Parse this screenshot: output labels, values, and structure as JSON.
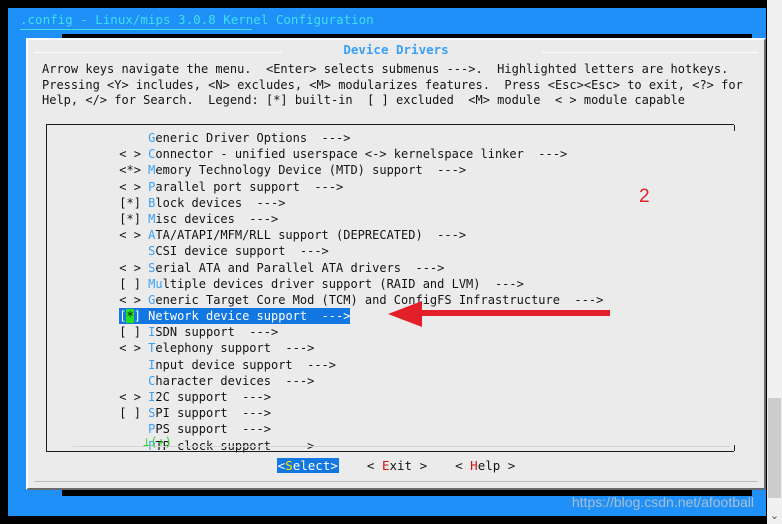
{
  "terminal": {
    "title": ".config - Linux/mips 3.0.8 Kernel Configuration"
  },
  "dialog": {
    "title": "Device Drivers",
    "help_line1": "Arrow keys navigate the menu.  <Enter> selects submenus --->.  Highlighted letters are hotkeys.",
    "help_line2": "Pressing <Y> includes, <N> excludes, <M> modularizes features.  Press <Esc><Esc> to exit, <?> for",
    "help_line3": "Help, </> for Search.  Legend: [*] built-in  [ ] excluded  <M> module  < > module capable",
    "scroll_indicator": "⊥(+)"
  },
  "menu": {
    "items": [
      {
        "tag": "    ",
        "hotkey": "G",
        "label": "eneric Driver Options  --->",
        "selected": false
      },
      {
        "tag": "< > ",
        "hotkey": "C",
        "label": "onnector - unified userspace <-> kernelspace linker  --->",
        "selected": false
      },
      {
        "tag": "<*> ",
        "hotkey": "M",
        "label": "emory Technology Device (MTD) support  --->",
        "selected": false
      },
      {
        "tag": "< > ",
        "hotkey": "P",
        "label": "arallel port support  --->",
        "selected": false
      },
      {
        "tag": "[*] ",
        "hotkey": "B",
        "label": "lock devices  --->",
        "selected": false
      },
      {
        "tag": "[*] ",
        "hotkey": "M",
        "label": "isc devices  --->",
        "selected": false
      },
      {
        "tag": "< > ",
        "hotkey": "A",
        "label": "TA/ATAPI/MFM/RLL support (DEPRECATED)  --->",
        "selected": false
      },
      {
        "tag": "    ",
        "hotkey": "S",
        "label": "CSI device support  --->",
        "selected": false
      },
      {
        "tag": "< > ",
        "hotkey": "S",
        "label": "erial ATA and Parallel ATA drivers  --->",
        "selected": false
      },
      {
        "tag": "[ ] ",
        "hotkey": "Mu",
        "label": "ltiple devices driver support (RAID and LVM)  --->",
        "selected": false
      },
      {
        "tag": "< > ",
        "hotkey": "G",
        "label": "eneric Target Core Mod (TCM) and ConfigFS Infrastructure  --->",
        "selected": false
      },
      {
        "tag": "[*] ",
        "hotkey": "N",
        "label": "etwork device support  --->",
        "selected": true
      },
      {
        "tag": "[ ] ",
        "hotkey": "I",
        "label": "SDN support  --->",
        "selected": false
      },
      {
        "tag": "< > ",
        "hotkey": "T",
        "label": "elephony support  --->",
        "selected": false
      },
      {
        "tag": "    ",
        "hotkey": "I",
        "label": "nput device support  --->",
        "selected": false
      },
      {
        "tag": "    ",
        "hotkey": "C",
        "label": "haracter devices  --->",
        "selected": false
      },
      {
        "tag": "< > ",
        "hotkey": "I",
        "label": "2C support  --->",
        "selected": false
      },
      {
        "tag": "[ ] ",
        "hotkey": "S",
        "label": "PI support  --->",
        "selected": false
      },
      {
        "tag": "    ",
        "hotkey": "P",
        "label": "PS support  --->",
        "selected": false
      },
      {
        "tag": "    ",
        "hotkey": "P",
        "label": "TP clock support  --->",
        "selected": false
      }
    ]
  },
  "buttons": {
    "select_pre": "<",
    "select_hotkey": "S",
    "select_post": "elect>",
    "exit_pre": "< ",
    "exit_hotkey": "E",
    "exit_post": "xit >",
    "help_pre": "< ",
    "help_hotkey": "H",
    "help_post": "elp >"
  },
  "annotations": {
    "step_number": "2",
    "arrow_color": "#e3202a"
  },
  "watermark": {
    "text": "https://blog.csdn.net/afootball"
  },
  "scrollbar": {
    "down_chevron": "⌄"
  },
  "colors": {
    "terminal_bg": "#1e90f8",
    "dialog_bg": "#ebebeb",
    "hotkey": "#3aa0f5",
    "selection": "#1277e0",
    "star_green": "#24e024",
    "title_cyan": "#3fe0f0",
    "accent_red": "#e3202a"
  }
}
